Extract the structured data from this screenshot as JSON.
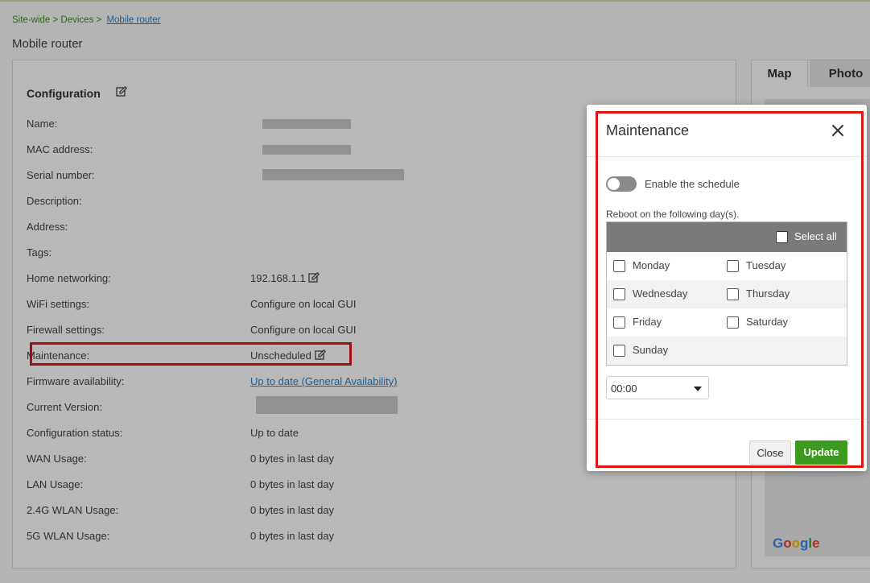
{
  "breadcrumb": {
    "site": "Site-wide",
    "sep1": " > ",
    "devices": "Devices",
    "sep2": " > ",
    "current": "Mobile router"
  },
  "page_title": "Mobile router",
  "configuration": {
    "title": "Configuration",
    "rows": [
      {
        "label": "Name:",
        "value": ""
      },
      {
        "label": "MAC address:",
        "value": ""
      },
      {
        "label": "Serial number:",
        "value": ""
      },
      {
        "label": "Description:",
        "value": ""
      },
      {
        "label": "Address:",
        "value": ""
      },
      {
        "label": "Tags:",
        "value": ""
      },
      {
        "label": "Home networking:",
        "value": "192.168.1.1"
      },
      {
        "label": "WiFi settings:",
        "value": "Configure on local GUI"
      },
      {
        "label": "Firewall settings:",
        "value": "Configure on local GUI"
      },
      {
        "label": "Maintenance:",
        "value": "Unscheduled"
      },
      {
        "label": "Firmware availability:",
        "value": "Up to date (General Availability)"
      },
      {
        "label": "Current Version:",
        "value": ""
      },
      {
        "label": "Configuration status:",
        "value": "Up to date"
      },
      {
        "label": "WAN Usage:",
        "value": "0 bytes in last day"
      },
      {
        "label": "LAN Usage:",
        "value": "0 bytes in last day"
      },
      {
        "label": "2.4G WLAN Usage:",
        "value": "0 bytes in last day"
      },
      {
        "label": "5G WLAN Usage:",
        "value": "0 bytes in last day"
      }
    ]
  },
  "side_panel": {
    "tabs": [
      "Map",
      "Photo"
    ],
    "map_attribution": "Google"
  },
  "modal": {
    "title": "Maintenance",
    "toggle_label": "Enable the schedule",
    "toggle_on": false,
    "reboot_label": "Reboot on the following day(s).",
    "select_all": "Select all",
    "days": [
      "Monday",
      "Tuesday",
      "Wednesday",
      "Thursday",
      "Friday",
      "Saturday",
      "Sunday"
    ],
    "time_value": "00:00",
    "close_label": "Close",
    "update_label": "Update"
  },
  "colors": {
    "accent_green": "#3c9a1e",
    "link_blue": "#2a83c4",
    "highlight_red": "#e01414"
  }
}
